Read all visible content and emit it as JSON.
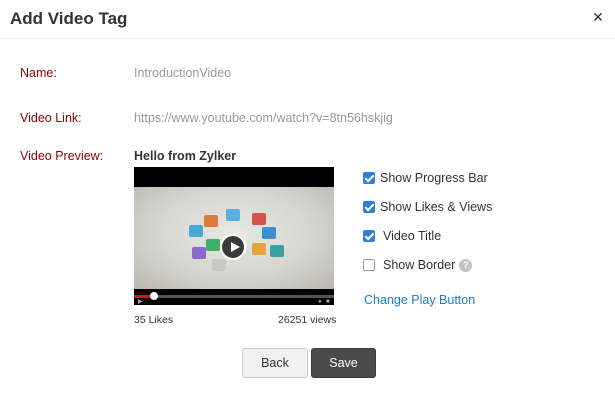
{
  "dialog": {
    "title": "Add Video Tag",
    "close_label": "✕"
  },
  "form": {
    "name_label": "Name:",
    "name_value": "IntroductionVideo",
    "link_label": "Video Link:",
    "link_value": "https://www.youtube.com/watch?v=8tn56hskjig",
    "preview_label": "Video Preview:"
  },
  "preview": {
    "video_title": "Hello from Zylker",
    "likes": "35 Likes",
    "views": "26251 views",
    "progress": 0.1
  },
  "options": [
    {
      "label": "Show Progress Bar",
      "checked": true
    },
    {
      "label": "Show Likes & Views",
      "checked": true
    },
    {
      "label": "Video Title",
      "checked": true
    },
    {
      "label": "Show Border",
      "checked": false
    }
  ],
  "help_glyph": "?",
  "change_play_button_label": "Change Play Button",
  "buttons": {
    "back": "Back",
    "save": "Save"
  },
  "colors": {
    "label": "#8b0000",
    "link": "#1a7fc1",
    "checkbox_checked": "#2f7fd8",
    "save_button": "#4a4a4a"
  },
  "icons": {
    "close": "close-icon",
    "help": "help-icon",
    "play": "play-icon"
  }
}
